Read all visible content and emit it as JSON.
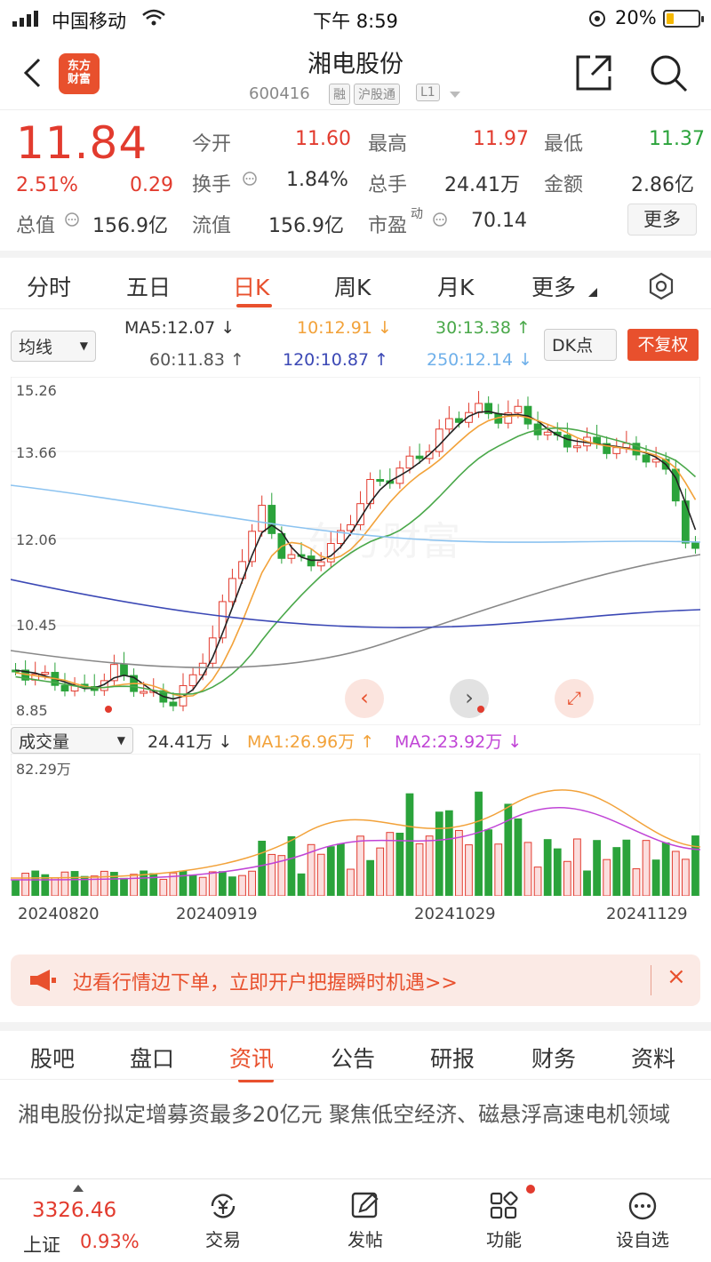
{
  "status_bar": {
    "carrier": "中国移动",
    "time": "下午 8:59",
    "battery": "20%"
  },
  "header": {
    "title": "湘电股份",
    "code": "600416",
    "tags": [
      "融",
      "沪股通",
      "L1"
    ],
    "logo_text": "东方\n财富"
  },
  "quote": {
    "price": "11.84",
    "change_pct": "2.51%",
    "change": "0.29",
    "market_cap_label": "总值",
    "market_cap": "156.9亿",
    "fields": [
      {
        "label": "今开",
        "value": "11.60",
        "color": "#e23b2e"
      },
      {
        "label": "最高",
        "value": "11.97",
        "color": "#e23b2e"
      },
      {
        "label": "最低",
        "value": "11.37",
        "color": "#2ba33b"
      },
      {
        "label": "换手",
        "value": "1.84%",
        "color": "#333333"
      },
      {
        "label": "总手",
        "value": "24.41万",
        "color": "#333333"
      },
      {
        "label": "金额",
        "value": "2.86亿",
        "color": "#333333"
      },
      {
        "label": "流值",
        "value": "156.9亿",
        "color": "#333333"
      },
      {
        "label": "市盈",
        "value": "70.14",
        "color": "#333333"
      }
    ],
    "pe_suffix": "动",
    "more_label": "更多"
  },
  "chart_tabs": [
    "分时",
    "五日",
    "日K",
    "周K",
    "月K",
    "更多"
  ],
  "active_chart_tab": 2,
  "ma_legend": {
    "selector": "均线",
    "ma5": "MA5:12.07",
    "ma10": "10:12.91",
    "ma30": "30:13.38",
    "ma60": "60:11.83",
    "ma120": "120:10.87",
    "ma250": "250:12.14",
    "dk": "DK点",
    "fq": "不复权"
  },
  "kline_axis": {
    "labels": [
      "15.26",
      "13.66",
      "12.06",
      "10.45",
      "8.85"
    ]
  },
  "volume_legend": {
    "selector": "成交量",
    "vol": "24.41万",
    "ma1": "MA1:26.96万",
    "ma2": "MA2:23.92万",
    "max": "82.29万"
  },
  "dates": [
    "20240820",
    "20240919",
    "20241029",
    "20241129"
  ],
  "watermark": "东方财富",
  "chart_data": {
    "type": "candlestick",
    "ylim": [
      8.85,
      15.26
    ],
    "volume_max": "82.29万",
    "x_labels": [
      "20240820",
      "20240919",
      "20241029",
      "20241129"
    ],
    "series": [
      {
        "name": "MA5",
        "color": "#222222"
      },
      {
        "name": "MA10",
        "color": "#f2a23a"
      },
      {
        "name": "MA30",
        "color": "#4aa84a"
      },
      {
        "name": "MA60",
        "color": "#888888"
      },
      {
        "name": "MA120",
        "color": "#3b48b5"
      },
      {
        "name": "MA250",
        "color": "#8cc3f0"
      }
    ]
  },
  "banner": {
    "text": "边看行情边下单，立即开户把握瞬时机遇>>",
    "close": "×"
  },
  "bottom_tabs": [
    "股吧",
    "盘口",
    "资讯",
    "公告",
    "研报",
    "财务",
    "资料"
  ],
  "active_bottom_tab": 2,
  "news": {
    "headline": "湘电股份拟定增募资最多20亿元 聚焦低空经济、磁悬浮高速电机领域"
  },
  "bottom_nav": {
    "index_value": "3326.46",
    "index_name": "上证",
    "index_change": "0.93%",
    "items": [
      "交易",
      "发帖",
      "功能",
      "设自选"
    ]
  }
}
